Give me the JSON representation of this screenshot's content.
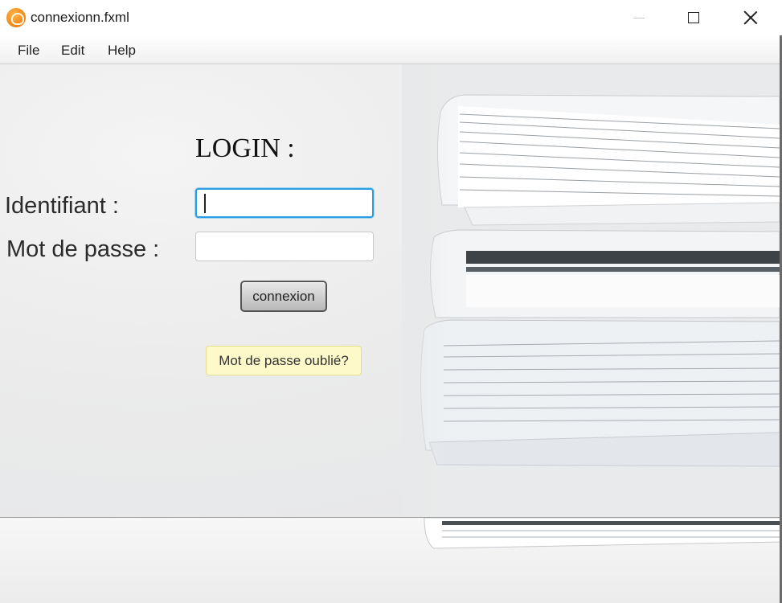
{
  "window": {
    "title": "connexionn.fxml"
  },
  "menu": {
    "file": "File",
    "edit": "Edit",
    "help": "Help"
  },
  "login": {
    "heading": "LOGIN :",
    "identifiant_label": "Identifiant :",
    "identifiant_value": "",
    "password_label": "Mot de passe :",
    "password_value": "",
    "connect_label": "connexion",
    "forgot_label": "Mot de passe oublié?"
  },
  "colors": {
    "focus_border": "#2a9ee0",
    "forgot_background": "#fef9c9",
    "app_icon": "#f08a1c"
  },
  "icons": {
    "app": "javafx-app-icon",
    "minimize": "minimize-icon",
    "maximize": "maximize-icon",
    "close": "close-icon"
  }
}
